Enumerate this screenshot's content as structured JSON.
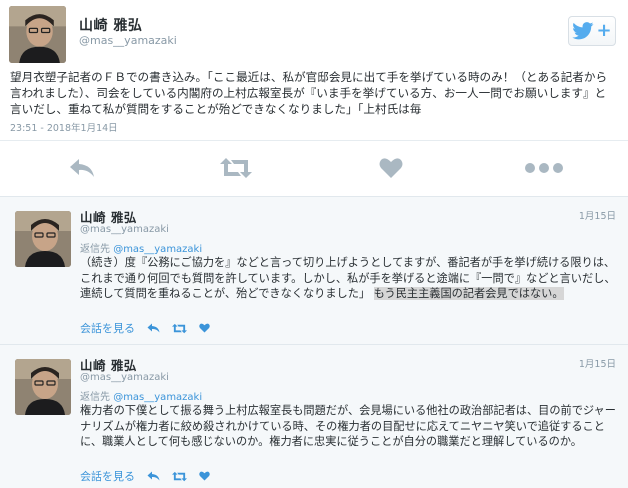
{
  "main_tweet": {
    "author_name": "山崎 雅弘",
    "author_handle": "@mas__yamazaki",
    "text": "望月衣塑子記者のＦＢでの書き込み。「ここ最近は、私が官邸会見に出て手を挙げている時のみ！（とある記者から言われました）、司会をしている内閣府の上村広報室長が『いま手を挙げている方、お一人一問でお願いします』と言いだし、重ねて私が質問をすることが殆どできなくなりました」「上村氏は毎",
    "timestamp": "23:51 - 2018年1月14日",
    "follow_icon": "twitter-bird-icon",
    "follow_plus": "+",
    "actions": [
      "reply-icon",
      "retweet-icon",
      "like-icon",
      "more-icon"
    ]
  },
  "replies": [
    {
      "author_name": "山崎 雅弘",
      "author_handle": "@mas__yamazaki",
      "date": "1月15日",
      "reply_to_label": "返信先",
      "reply_to_handle": "@mas__yamazaki",
      "text_main": "（続き）度『公務にご協力を』などと言って切り上げようとしてますが、番記者が手を挙げ続ける限りは、これまで通り何回でも質問を許しています。しかし、私が手を挙げると途端に『一問で』などと言いだし、連続して質問を重ねることが、殆どできなくなりました」",
      "text_highlight": "もう民主主義国の記者会見ではない。",
      "conversation_label": "会話を見る"
    },
    {
      "author_name": "山崎 雅弘",
      "author_handle": "@mas__yamazaki",
      "date": "1月15日",
      "reply_to_label": "返信先",
      "reply_to_handle": "@mas__yamazaki",
      "text_main": "権力者の下僕として振る舞う上村広報室長も問題だが、会見場にいる他社の政治部記者は、目の前でジャーナリズムが権力者に絞め殺されかけている時、その権力者の目配せに応えてニヤニヤ笑いで追従することに、職業人として何も感じないのか。権力者に忠実に従うことが自分の職業だと理解しているのか。",
      "text_highlight": "",
      "conversation_label": "会話を見る"
    }
  ],
  "colors": {
    "link": "#3b94d9",
    "twitter_blue": "#55acee",
    "muted": "#8899a6",
    "icon_gray": "#aab8c2",
    "reply_bg": "#f5f8fa"
  }
}
